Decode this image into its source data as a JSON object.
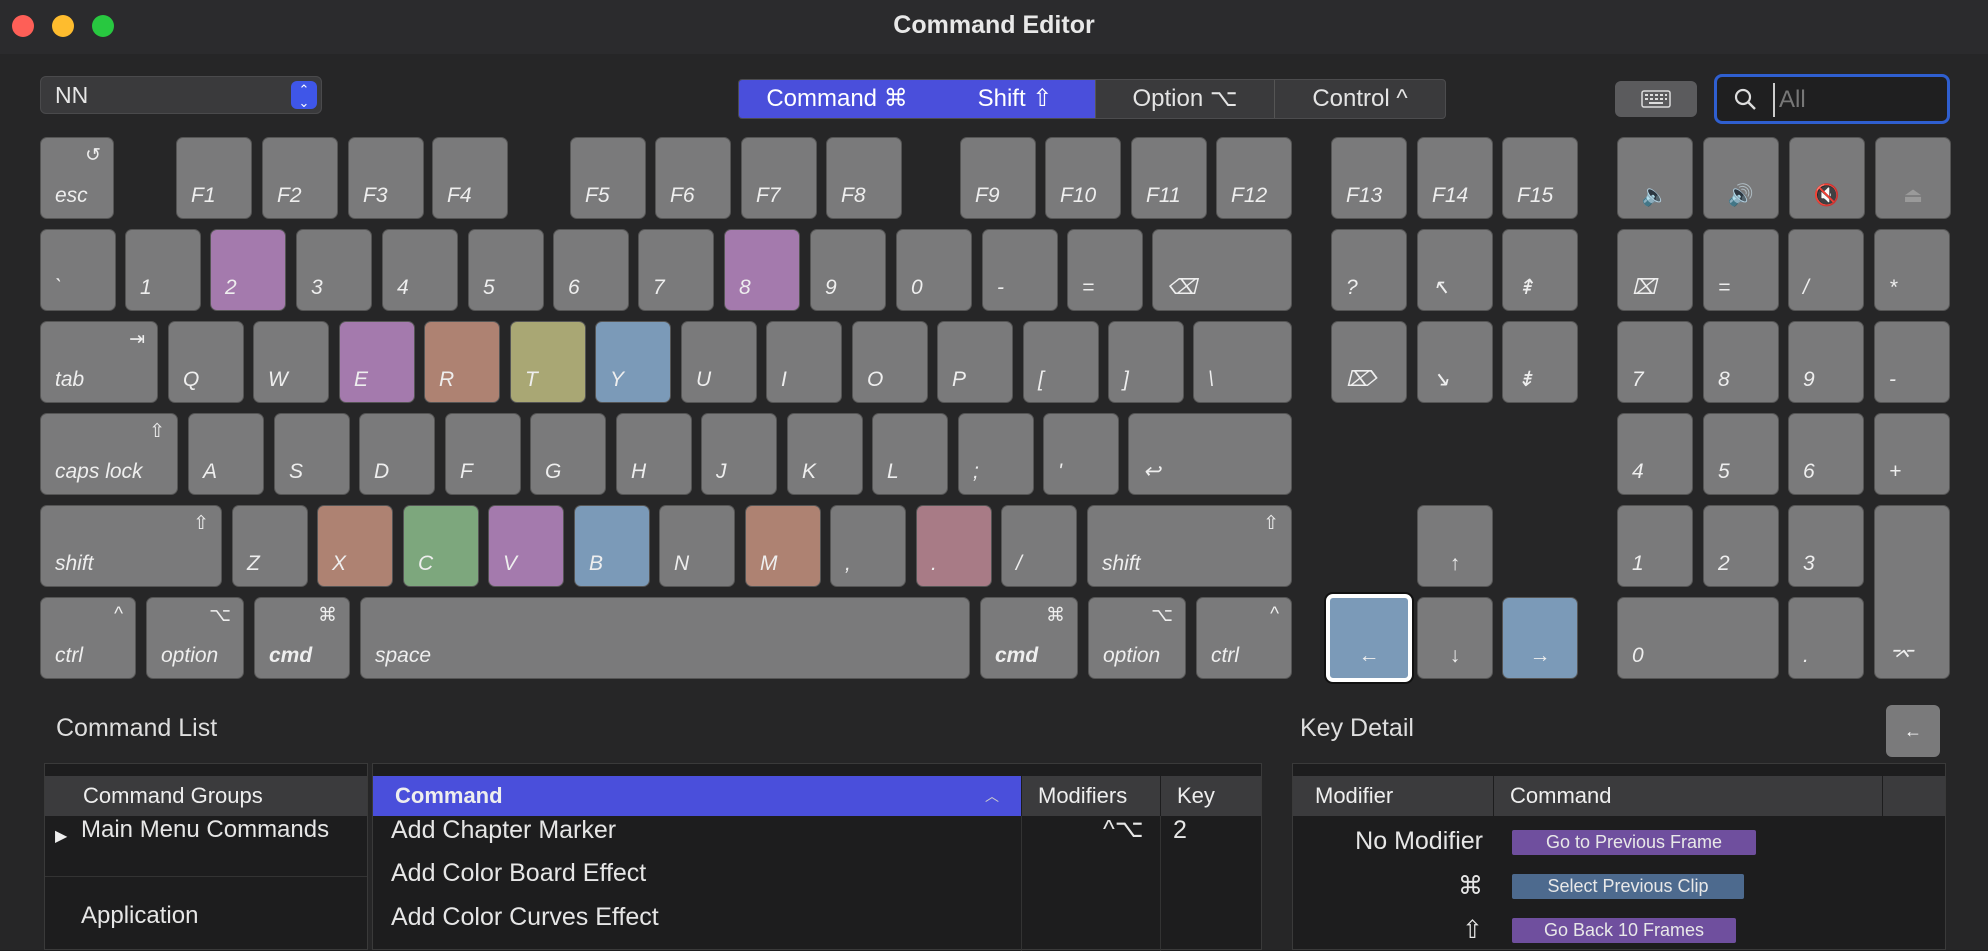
{
  "window": {
    "title": "Command Editor"
  },
  "colors": {
    "close": "#fe5f57",
    "minimize": "#febc2e",
    "maximize": "#28c840",
    "accent": "#4a4fdb"
  },
  "toolbar": {
    "preset": "NN",
    "modifiers": [
      {
        "label": "Command ⌘",
        "active": true
      },
      {
        "label": "Shift ⇧",
        "active": true
      },
      {
        "label": "Option ⌥",
        "active": false
      },
      {
        "label": "Control ^",
        "active": false
      }
    ],
    "keyboard_icon": "keyboard-icon",
    "search": {
      "value": "",
      "placeholder": "All"
    }
  },
  "keyboard": {
    "function_row": [
      "esc",
      "F1",
      "F2",
      "F3",
      "F4",
      "F5",
      "F6",
      "F7",
      "F8",
      "F9",
      "F10",
      "F11",
      "F12",
      "F13",
      "F14",
      "F15"
    ],
    "number_row": [
      "`",
      "1",
      "2",
      "3",
      "4",
      "5",
      "6",
      "7",
      "8",
      "9",
      "0",
      "-",
      "=",
      "⌫"
    ],
    "qwerty_row": [
      "tab",
      "Q",
      "W",
      "E",
      "R",
      "T",
      "Y",
      "U",
      "I",
      "O",
      "P",
      "[",
      "]",
      "\\"
    ],
    "home_row": [
      "caps lock",
      "A",
      "S",
      "D",
      "F",
      "G",
      "H",
      "J",
      "K",
      "L",
      ";",
      "'",
      "↩"
    ],
    "shift_row": [
      "shift",
      "Z",
      "X",
      "C",
      "V",
      "B",
      "N",
      "M",
      ",",
      ".",
      "/",
      "shift"
    ],
    "bottom_row": [
      "ctrl",
      "option",
      "cmd",
      "space",
      "cmd",
      "option",
      "ctrl"
    ],
    "nav_keys": [
      "?",
      "↖",
      "⇞",
      "⌦",
      "↘",
      "⇟",
      "↑",
      "←",
      "↓",
      "→"
    ],
    "numpad": [
      "⌧",
      "=",
      "/",
      "*",
      "7",
      "8",
      "9",
      "-",
      "4",
      "5",
      "6",
      "+",
      "1",
      "2",
      "3",
      "0",
      ".",
      "⌤"
    ],
    "modifier_symbols": {
      "tab": "⇥",
      "caps": "⇧",
      "shift": "⇧",
      "ctrl": "^",
      "option": "⌥",
      "cmd": "⌘",
      "esc": "↺"
    }
  },
  "command_list": {
    "title": "Command List",
    "groups_header": "Command Groups",
    "groups": [
      "Main Menu Commands",
      "Application",
      ""
    ],
    "columns": {
      "command": "Command",
      "modifiers": "Modifiers",
      "key": "Key"
    },
    "rows": [
      {
        "command": "Add Chapter Marker",
        "modifiers": "^⌥",
        "key": "2"
      },
      {
        "command": "Add Color Board Effect",
        "modifiers": "",
        "key": ""
      },
      {
        "command": "Add Color Curves Effect",
        "modifiers": "",
        "key": ""
      }
    ]
  },
  "key_detail": {
    "title": "Key Detail",
    "button_glyph": "←",
    "columns": {
      "modifier": "Modifier",
      "command": "Command"
    },
    "rows": [
      {
        "modifier": "No Modifier",
        "command": "Go to Previous Frame",
        "color": "#6f4f9e"
      },
      {
        "modifier": "⌘",
        "command": "Select Previous Clip",
        "color": "#4d6a8e"
      },
      {
        "modifier": "⇧",
        "command": "Go Back 10 Frames",
        "color": "#6f4f9e"
      }
    ]
  }
}
